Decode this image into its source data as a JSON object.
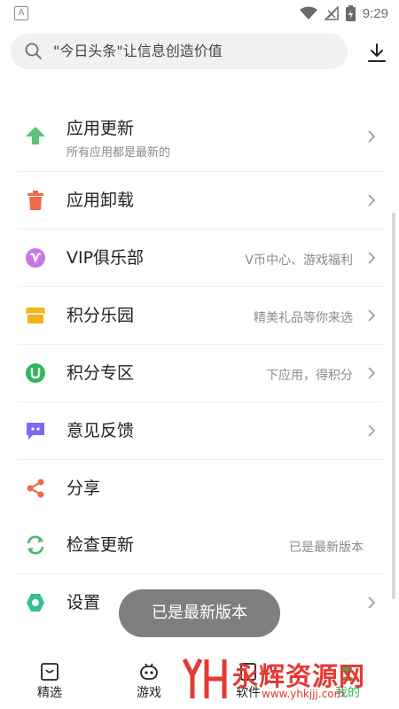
{
  "status_bar": {
    "time": "9:29"
  },
  "search": {
    "placeholder": "\"今日头条\"让信息创造价值"
  },
  "menu": [
    {
      "label": "应用更新",
      "sub": "所有应用都是最新的",
      "icon": "arrow-up-icon",
      "color": "#5cc27a"
    },
    {
      "label": "应用卸载",
      "icon": "trash-icon",
      "color": "#f06a4a"
    },
    {
      "label": "VIP俱乐部",
      "right": "V币中心、游戏福利",
      "icon": "vip-icon",
      "color": "#c977e8"
    },
    {
      "label": "积分乐园",
      "right": "精美礼品等你来选",
      "icon": "store-icon",
      "color": "#f6b21a"
    },
    {
      "label": "积分专区",
      "right": "下应用，得积分",
      "icon": "u-badge-icon",
      "color": "#2eb85c"
    },
    {
      "label": "意见反馈",
      "icon": "feedback-icon",
      "color": "#7d6cf0"
    },
    {
      "label": "分享",
      "icon": "share-icon",
      "color": "#f06a4a"
    },
    {
      "label": "检查更新",
      "right": "已是最新版本",
      "icon": "refresh-icon",
      "color": "#4cb86a"
    },
    {
      "label": "设置",
      "icon": "settings-icon",
      "color": "#31c28c"
    }
  ],
  "toast": "已是最新版本",
  "bottom_nav": {
    "tabs": [
      {
        "label": "精选",
        "icon": "featured-icon"
      },
      {
        "label": "游戏",
        "icon": "gamepad-icon"
      },
      {
        "label": "软件",
        "icon": "apps-icon"
      },
      {
        "label": "我的",
        "icon": "profile-icon"
      }
    ]
  },
  "watermark": {
    "text": "永辉资源网",
    "url": "www.yhkjjj.com",
    "logo": "YH"
  },
  "colors": {
    "active": "#2eb85c",
    "toast_bg": "#7f7f7f",
    "search_bg": "#f1f1f1"
  }
}
